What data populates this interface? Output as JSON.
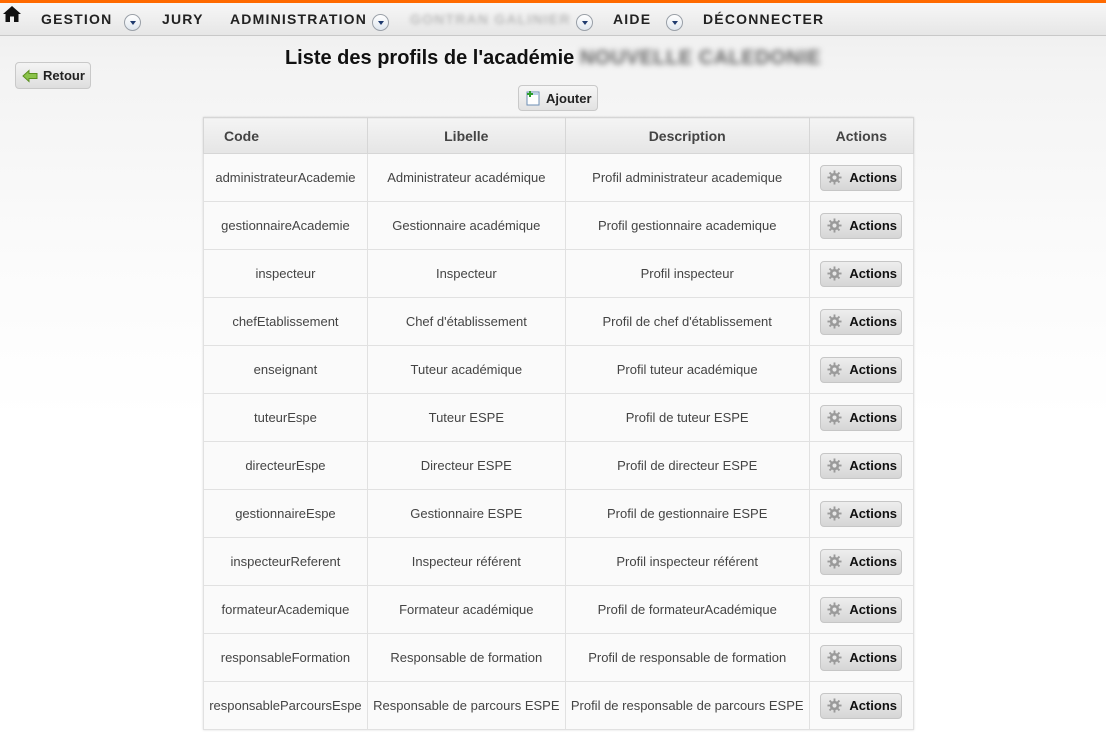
{
  "nav": {
    "items": [
      {
        "label": "GESTION",
        "has_dropdown": true
      },
      {
        "label": "JURY",
        "has_dropdown": false
      },
      {
        "label": "ADMINISTRATION",
        "has_dropdown": true
      },
      {
        "label": "GONTRAN GALINIER",
        "has_dropdown": true,
        "blurred": true
      },
      {
        "label": "AIDE",
        "has_dropdown": true
      },
      {
        "label": "DÉCONNECTER",
        "has_dropdown": false
      }
    ],
    "home_icon": "home-icon",
    "accent_color": "#ff6a00"
  },
  "back_button": {
    "label": "Retour",
    "icon": "arrow-left-icon"
  },
  "page": {
    "title": "Liste des profils de l'académie",
    "academy_name": "NOUVELLE CALEDONIE"
  },
  "add_button": {
    "label": "Ajouter",
    "icon": "add-document-icon"
  },
  "table": {
    "headers": {
      "code": "Code",
      "libelle": "Libelle",
      "description": "Description",
      "actions": "Actions"
    },
    "rows": [
      {
        "code": "administrateurAcademie",
        "libelle": "Administrateur académique",
        "description": "Profil administrateur academique",
        "action": "Actions"
      },
      {
        "code": "gestionnaireAcademie",
        "libelle": "Gestionnaire académique",
        "description": "Profil gestionnaire academique",
        "action": "Actions"
      },
      {
        "code": "inspecteur",
        "libelle": "Inspecteur",
        "description": "Profil inspecteur",
        "action": "Actions"
      },
      {
        "code": "chefEtablissement",
        "libelle": "Chef d'établissement",
        "description": "Profil de chef d'établissement",
        "action": "Actions"
      },
      {
        "code": "enseignant",
        "libelle": "Tuteur académique",
        "description": "Profil tuteur académique",
        "action": "Actions"
      },
      {
        "code": "tuteurEspe",
        "libelle": "Tuteur ESPE",
        "description": "Profil de tuteur ESPE",
        "action": "Actions"
      },
      {
        "code": "directeurEspe",
        "libelle": "Directeur ESPE",
        "description": "Profil de directeur ESPE",
        "action": "Actions"
      },
      {
        "code": "gestionnaireEspe",
        "libelle": "Gestionnaire ESPE",
        "description": "Profil de gestionnaire ESPE",
        "action": "Actions"
      },
      {
        "code": "inspecteurReferent",
        "libelle": "Inspecteur référent",
        "description": "Profil inspecteur référent",
        "action": "Actions"
      },
      {
        "code": "formateurAcademique",
        "libelle": "Formateur académique",
        "description": "Profil de formateurAcadémique",
        "action": "Actions"
      },
      {
        "code": "responsableFormation",
        "libelle": "Responsable de formation",
        "description": "Profil de responsable de formation",
        "action": "Actions"
      },
      {
        "code": "responsableParcoursEspe",
        "libelle": "Responsable de parcours ESPE",
        "description": "Profil de responsable de parcours ESPE",
        "action": "Actions"
      }
    ]
  }
}
